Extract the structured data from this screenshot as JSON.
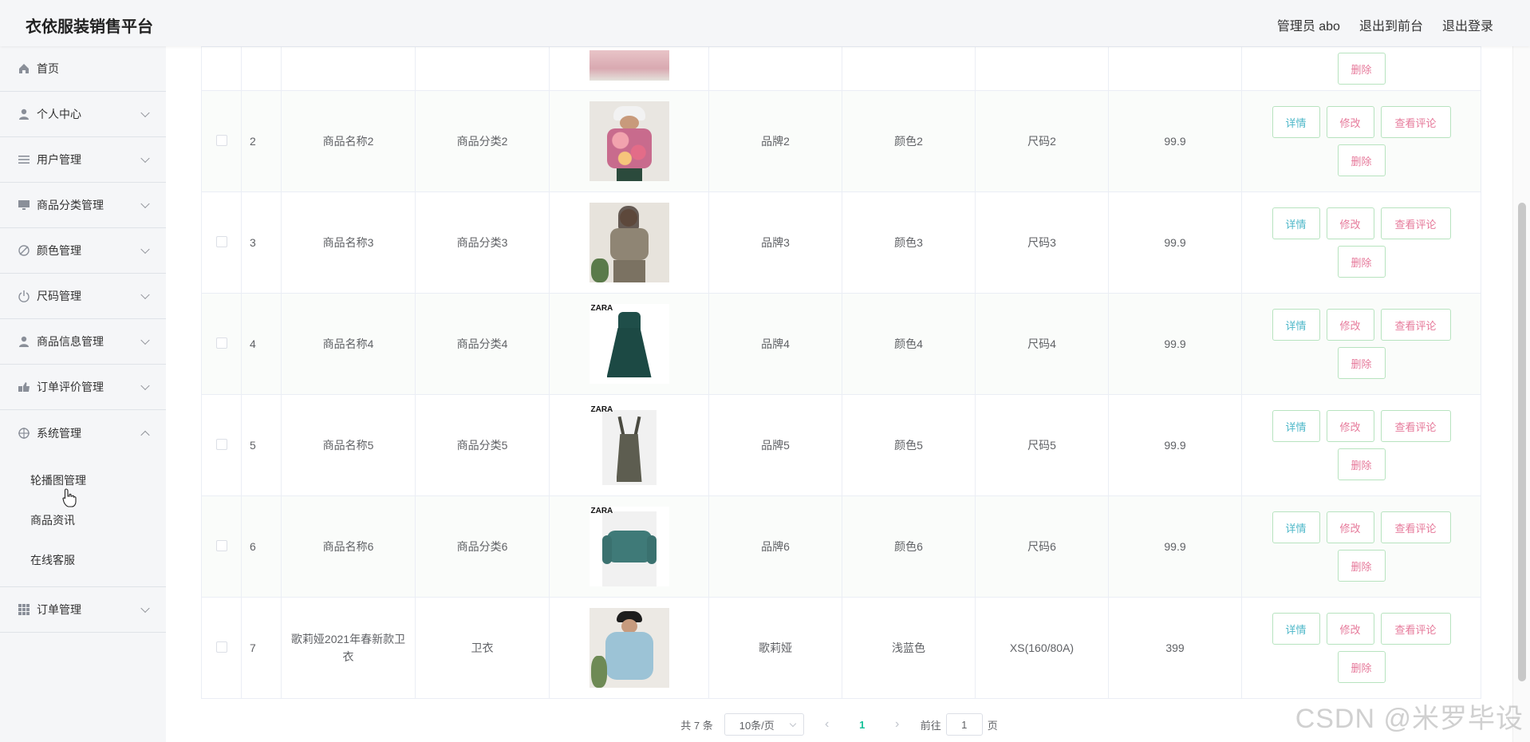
{
  "header": {
    "brand": "衣依服装销售平台",
    "user": "管理员 abo",
    "back_front": "退出到前台",
    "logout": "退出登录"
  },
  "sidebar": {
    "items": [
      {
        "label": "首页",
        "icon": "home-icon"
      },
      {
        "label": "个人中心",
        "icon": "user-icon"
      },
      {
        "label": "用户管理",
        "icon": "list-icon"
      },
      {
        "label": "商品分类管理",
        "icon": "monitor-icon"
      },
      {
        "label": "颜色管理",
        "icon": "no-icon"
      },
      {
        "label": "尺码管理",
        "icon": "power-icon"
      },
      {
        "label": "商品信息管理",
        "icon": "user-icon"
      },
      {
        "label": "订单评价管理",
        "icon": "comment-icon"
      },
      {
        "label": "系统管理",
        "icon": "setting-icon"
      }
    ],
    "system_sub": [
      "轮播图管理",
      "商品资讯",
      "在线客服"
    ],
    "order": {
      "label": "订单管理",
      "icon": "grid-icon"
    }
  },
  "table": {
    "buttons": {
      "detail": "详情",
      "edit": "修改",
      "comment": "查看评论",
      "delete": "删除"
    },
    "partial_row": {
      "delete": "删除"
    },
    "rows": [
      {
        "index": "2",
        "name": "商品名称2",
        "category": "商品分类2",
        "brand": "品牌2",
        "color": "颜色2",
        "size": "尺码2",
        "price": "99.9",
        "image": "floral-jacket"
      },
      {
        "index": "3",
        "name": "商品名称3",
        "category": "商品分类3",
        "brand": "品牌3",
        "color": "颜色3",
        "size": "尺码3",
        "price": "99.9",
        "image": "knit-set"
      },
      {
        "index": "4",
        "name": "商品名称4",
        "category": "商品分类4",
        "brand": "品牌4",
        "color": "颜色4",
        "size": "尺码4",
        "price": "99.9",
        "image": "green-dress"
      },
      {
        "index": "5",
        "name": "商品名称5",
        "category": "商品分类5",
        "brand": "品牌5",
        "color": "颜色5",
        "size": "尺码5",
        "price": "99.9",
        "image": "pinafore"
      },
      {
        "index": "6",
        "name": "商品名称6",
        "category": "商品分类6",
        "brand": "品牌6",
        "color": "颜色6",
        "size": "尺码6",
        "price": "99.9",
        "image": "teal-sweater"
      },
      {
        "index": "7",
        "name": "歌莉娅2021年春新款卫衣",
        "category": "卫衣",
        "brand": "歌莉娅",
        "color": "浅蓝色",
        "size": "XS(160/80A)",
        "price": "399",
        "image": "blue-hoodie"
      }
    ]
  },
  "pagination": {
    "total": "共 7 条",
    "page_size": "10条/页",
    "current": "1",
    "goto_prefix": "前往",
    "goto_value": "1",
    "goto_suffix": "页"
  },
  "watermark": "CSDN @米罗毕设"
}
